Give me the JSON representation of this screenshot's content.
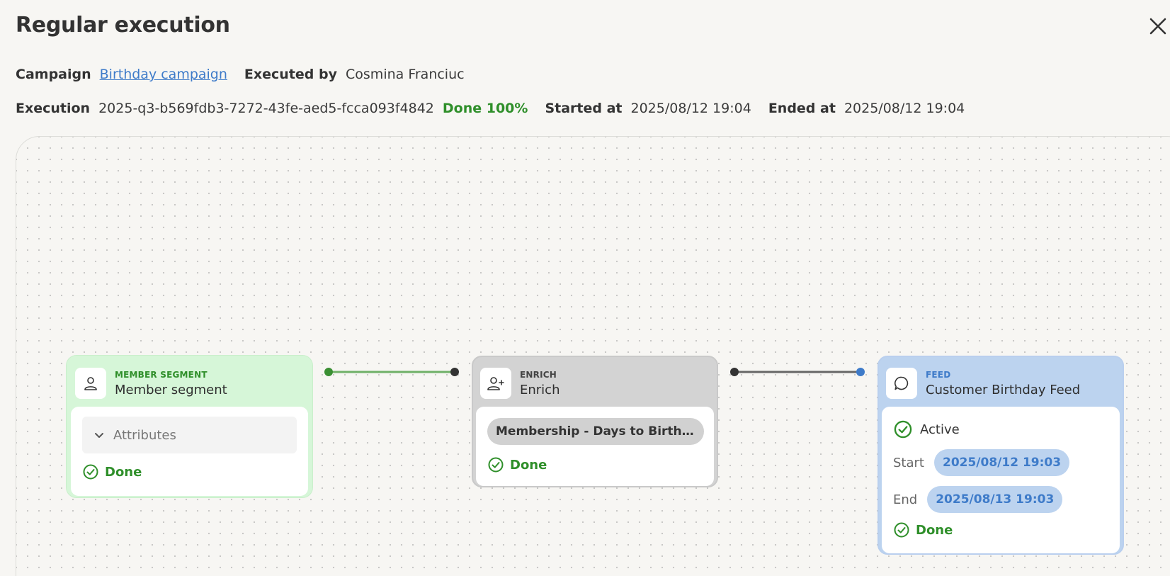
{
  "dialog": {
    "title": "Regular execution"
  },
  "meta": {
    "campaign_label": "Campaign",
    "campaign_value": "Birthday campaign",
    "executed_by_label": "Executed by",
    "executed_by_value": "Cosmina Franciuc",
    "execution_label": "Execution",
    "execution_id": "2025-q3-b569fdb3-7272-43fe-aed5-fcca093f4842",
    "status": "Done 100%",
    "started_label": "Started at",
    "started_value": "2025/08/12 19:04",
    "ended_label": "Ended at",
    "ended_value": "2025/08/12 19:04"
  },
  "flow": {
    "nodes": [
      {
        "kind": "MEMBER SEGMENT",
        "name": "Member segment",
        "icon": "user-icon",
        "attributes_label": "Attributes",
        "status": "Done"
      },
      {
        "kind": "ENRICH",
        "name": "Enrich",
        "icon": "user-plus-icon",
        "attribute": "Membership - Days to Birthday",
        "status": "Done"
      },
      {
        "kind": "FEED",
        "name": "Customer Birthday Feed",
        "icon": "chat-bubble-icon",
        "state": "Active",
        "start_label": "Start",
        "start_value": "2025/08/12 19:03",
        "end_label": "End",
        "end_value": "2025/08/13 19:03",
        "status": "Done"
      }
    ]
  },
  "colors": {
    "done_green": "#2f8f2a",
    "link_blue": "#3e7bc9",
    "segment_bg": "#d6f6d8",
    "enrich_bg": "#d3d3d3",
    "feed_bg": "#bcd3ef"
  }
}
